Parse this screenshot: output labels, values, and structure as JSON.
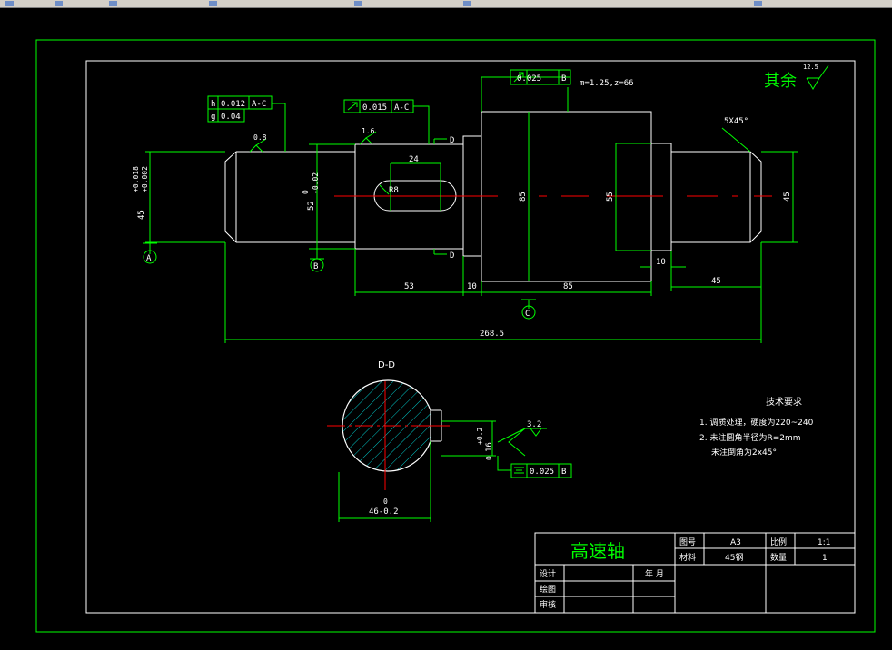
{
  "part_name": "高速轴",
  "roughness_note": {
    "prefix": "其余",
    "value": "12.5"
  },
  "tolerance_frames": {
    "top_runout": {
      "value": "0.025",
      "datum": "B"
    },
    "left_h": {
      "sym": "h",
      "value": "0.012",
      "datum": "A-C"
    },
    "left_g": {
      "sym": "g",
      "value": "0.04"
    },
    "mid_runout": {
      "value": "0.015",
      "datum": "A-C"
    },
    "key_sym": {
      "value": "0.025",
      "datum": "B"
    }
  },
  "gear_spec": "m=1.25,z=66",
  "chamfer": "5X45°",
  "dims": {
    "slot_len": "24",
    "slot_r": "R8",
    "d_left_main": "45",
    "d_left_up": "+0.018",
    "d_left_low": "+0.002",
    "d_mid_main": "52",
    "d_mid_up": "0",
    "d_mid_low": "-0.02",
    "d_gear": "85",
    "d_hub": "55",
    "d_right": "45",
    "len_53": "53",
    "len_10a": "10",
    "len_85": "85",
    "len_10b": "10",
    "len_45": "45",
    "total": "268.5",
    "key_depth": "16",
    "key_depth_up": "+0.2",
    "key_depth_low": "0",
    "sec_dia": "46-0.2",
    "sec_dia_up": "0"
  },
  "roughness_marks": {
    "r1": "0.8",
    "r2": "1.6",
    "r3": "3.2"
  },
  "datums": {
    "a": "A",
    "b": "B",
    "c": "C"
  },
  "section": {
    "title": "D-D",
    "mark_top": "D",
    "mark_bot": "D"
  },
  "tech_req": {
    "title": "技术要求",
    "items": [
      "1. 调质处理，硬度为220~240",
      "2. 未注圆角半径为R=2mm",
      "未注倒角为2x45°"
    ]
  },
  "title_block": {
    "drawing_no_label": "图号",
    "drawing_no": "A3",
    "scale_label": "比例",
    "scale": "1:1",
    "material_label": "材料",
    "material": "45钢",
    "qty_label": "数量",
    "qty": "1",
    "design": "设计",
    "draw": "绘图",
    "review": "审核",
    "date": "年 月"
  },
  "colors": {
    "line": "#00ff00",
    "text": "#ffffff",
    "center": "#ff0000",
    "hatch": "#00c8c8"
  }
}
